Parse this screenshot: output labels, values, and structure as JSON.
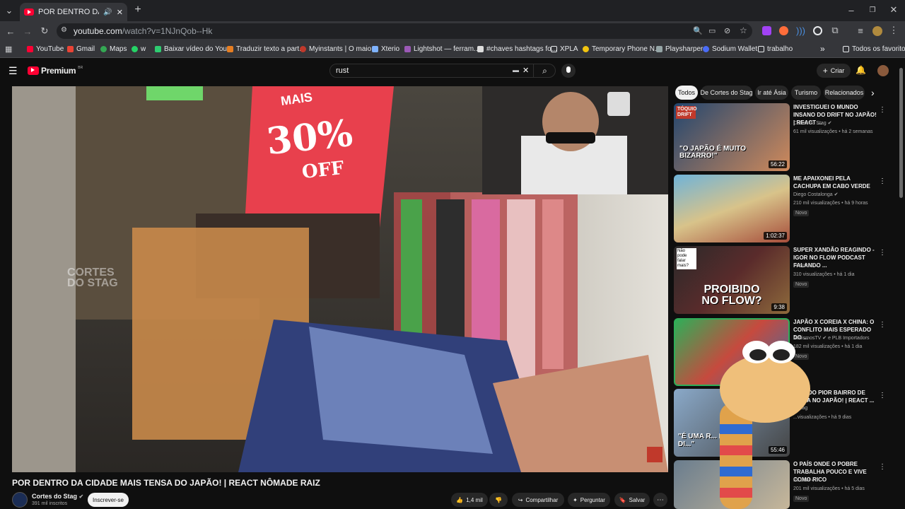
{
  "browser": {
    "tab_title": "POR DENTRO DA CIDADE MAIS TENSA DO JAPÃO! | REACT NÔMADE RAIZ",
    "url_host": "youtube.com",
    "url_path": "/watch?v=1NJnQob--Hk",
    "bookmarks": [
      "YouTube",
      "Gmail",
      "Maps",
      "w",
      "Baixar vídeo do You...",
      "Traduzir texto a part...",
      "Myinstants | O maio...",
      "Xterio",
      "Lightshot — ferram...",
      "#chaves hashtags fo...",
      "XPLA",
      "Temporary Phone N...",
      "Playsharper",
      "Sodium Wallet",
      "trabalho"
    ],
    "bookmarks_overflow": "»",
    "all_bookmarks": "Todos os favoritos"
  },
  "youtube": {
    "logo_text": "Premium",
    "logo_sup": "BR",
    "search_value": "rust",
    "create_label": "Criar",
    "chips": [
      "Todos",
      "De Cortes do Stag",
      "Ir até Ásia",
      "Turismo",
      "Relacionados"
    ]
  },
  "video": {
    "title": "POR DENTRO DA CIDADE MAIS TENSA DO JAPÃO! | REACT NÔMADE RAIZ",
    "channel": "Cortes do Stag",
    "subscribers": "391 mil inscritos",
    "subscribe_label": "Inscrever-se",
    "likes": "1,4 mil",
    "share_label": "Compartilhar",
    "ask_label": "Perguntar",
    "save_label": "Salvar",
    "overlay_sign_top": "MAIS",
    "overlay_sign_main": "30%",
    "overlay_sign_off": "OFF",
    "watermark": "CORTES DO STAG"
  },
  "recommendations": [
    {
      "title": "INVESTIGUEI O MUNDO INSANO DO DRIFT NO JAPÃO! | REACT ...",
      "channel": "Cortes do Stag",
      "meta": "61 mil visualizações • há 2 semanas",
      "duration": "56:22",
      "badge": "",
      "thumb_text": "\"O JAPÃO É MUITO BIZARRO!\"",
      "thumb_tag": "TÓQUIO DRIFT",
      "verified": true
    },
    {
      "title": "ME APAIXONEI PELA CACHUPA EM CABO VERDE",
      "channel": "Diego Costalonga",
      "meta": "210 mil visualizações • há 9 horas",
      "duration": "1:02:37",
      "badge": "Novo",
      "thumb_text": "",
      "thumb_tag": "",
      "verified": true
    },
    {
      "title": "SUPER XANDÃO REAGINDO - IGOR NO FLOW PODCAST FALANDO ...",
      "channel": "Inosuke Tv",
      "meta": "310 visualizações • há 1 dia",
      "duration": "9:38",
      "badge": "Novo",
      "thumb_text": "PROIBIDO NO FLOW?",
      "thumb_tag": "Não pode falar mais?",
      "verified": false
    },
    {
      "title": "JAPÃO X COREIA X CHINA: O CONFLITO MAIS ESPERADO DO ...",
      "channel": "AchismosTV",
      "channel2": "e PLB Importadors",
      "meta": "182 mil visualizações • há 1 dia",
      "duration": "",
      "badge": "Novo",
      "thumb_text": "",
      "thumb_tag": "",
      "verified": true
    },
    {
      "title": "...RO DO PIOR BAIRRO DE ...AMA NO JAPÃO! | REACT ...",
      "channel": "...Stag",
      "meta": "...visualizações • há 9 dias",
      "duration": "55:46",
      "badge": "",
      "thumb_text": "\"É UMA R... MUITO DI...\"",
      "thumb_tag": "",
      "verified": true
    },
    {
      "title": "O PAÍS ONDE O POBRE TRABALHA POUCO E VIVE COMO RICO",
      "channel": "Fe Leal",
      "meta": "201 mil visualizações • há 5 dias",
      "duration": "",
      "badge": "Novo",
      "thumb_text": "",
      "thumb_tag": "",
      "verified": true
    }
  ],
  "colors": {
    "accent_red": "#ff0033",
    "bg": "#0f0f0f",
    "chip_active": "#f1f1f1"
  }
}
